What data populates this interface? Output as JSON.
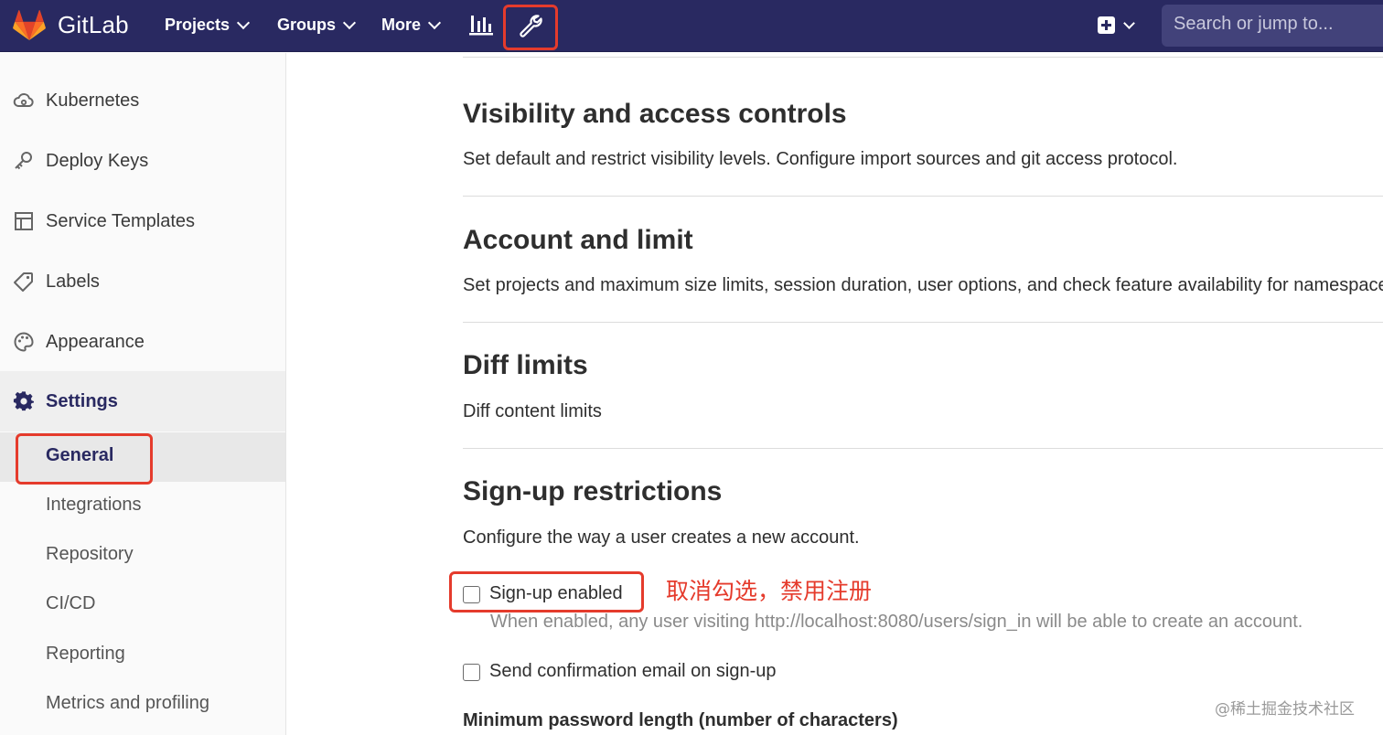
{
  "navbar": {
    "brand": "GitLab",
    "projects": "Projects",
    "groups": "Groups",
    "more": "More",
    "search_placeholder": "Search or jump to...",
    "colors": {
      "background": "#292961",
      "highlight": "#e53b2c"
    }
  },
  "sidebar": {
    "items": [
      {
        "label": "Kubernetes",
        "icon": "cloud-gear-icon"
      },
      {
        "label": "Deploy Keys",
        "icon": "key-icon"
      },
      {
        "label": "Service Templates",
        "icon": "template-icon"
      },
      {
        "label": "Labels",
        "icon": "label-tag-icon"
      },
      {
        "label": "Appearance",
        "icon": "palette-icon"
      },
      {
        "label": "Settings",
        "icon": "gear-icon",
        "active": true
      }
    ],
    "subitems": [
      {
        "label": "General",
        "active": true
      },
      {
        "label": "Integrations"
      },
      {
        "label": "Repository"
      },
      {
        "label": "CI/CD"
      },
      {
        "label": "Reporting"
      },
      {
        "label": "Metrics and profiling"
      }
    ]
  },
  "main": {
    "sections": [
      {
        "title": "Visibility and access controls",
        "description": "Set default and restrict visibility levels. Configure import sources and git access protocol."
      },
      {
        "title": "Account and limit",
        "description": "Set projects and maximum size limits, session duration, user options, and check feature availability for namespace plan."
      },
      {
        "title": "Diff limits",
        "description": "Diff content limits"
      },
      {
        "title": "Sign-up restrictions",
        "description": "Configure the way a user creates a new account."
      }
    ],
    "signup_enabled": {
      "label": "Sign-up enabled",
      "checked": false,
      "help": "When enabled, any user visiting http://localhost:8080/users/sign_in will be able to create an account."
    },
    "send_confirmation": {
      "label": "Send confirmation email on sign-up",
      "checked": false
    },
    "min_password_label": "Minimum password length (number of characters)",
    "annotation": "取消勾选，禁用注册"
  },
  "watermark": "@稀土掘金技术社区"
}
